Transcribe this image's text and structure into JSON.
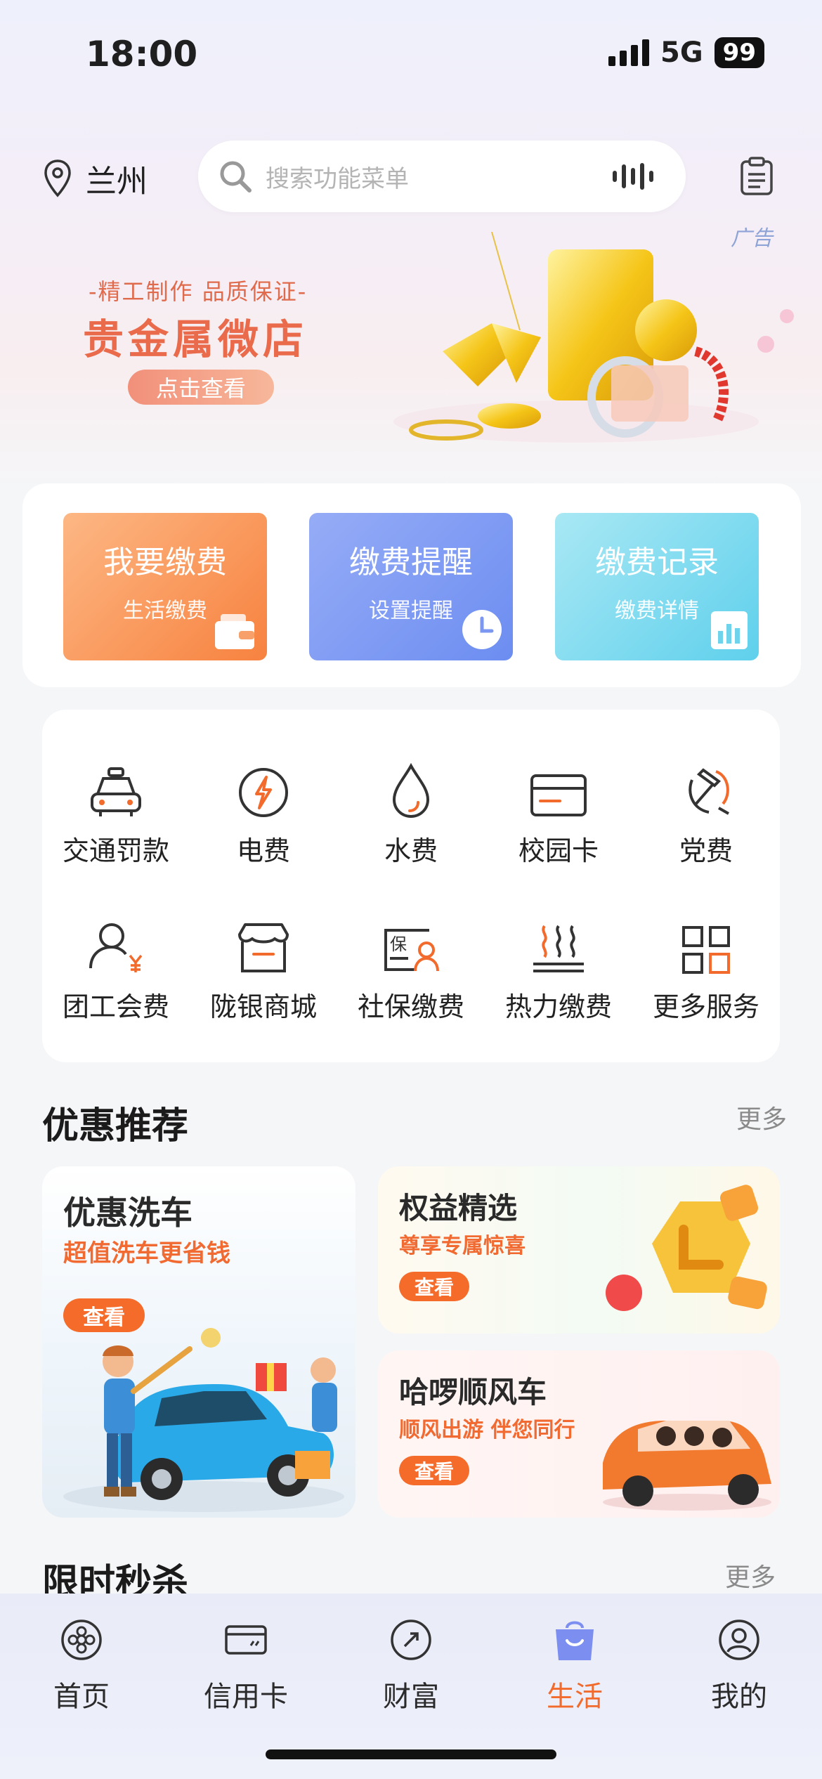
{
  "status": {
    "time": "18:00",
    "network": "5G",
    "battery": "99"
  },
  "header": {
    "location": "兰州",
    "search_placeholder": "搜索功能菜单",
    "ad_label": "广告"
  },
  "banner": {
    "subtitle": "-精工制作 品质保证-",
    "title": "贵金属微店",
    "button": "点击查看"
  },
  "quick_actions": [
    {
      "title": "我要缴费",
      "sub": "生活缴费",
      "icon": "wallet-icon"
    },
    {
      "title": "缴费提醒",
      "sub": "设置提醒",
      "icon": "clock-icon"
    },
    {
      "title": "缴费记录",
      "sub": "缴费详情",
      "icon": "chart-icon"
    }
  ],
  "services": [
    {
      "label": "交通罚款",
      "icon": "car-icon"
    },
    {
      "label": "电费",
      "icon": "lightning-icon"
    },
    {
      "label": "水费",
      "icon": "water-drop-icon"
    },
    {
      "label": "校园卡",
      "icon": "card-icon"
    },
    {
      "label": "党费",
      "icon": "party-emblem-icon"
    },
    {
      "label": "团工会费",
      "icon": "union-fee-icon"
    },
    {
      "label": "陇银商城",
      "icon": "store-icon"
    },
    {
      "label": "社保缴费",
      "icon": "social-security-icon"
    },
    {
      "label": "热力缴费",
      "icon": "heating-icon"
    },
    {
      "label": "更多服务",
      "icon": "grid-icon"
    }
  ],
  "promo_section": {
    "title": "优惠推荐",
    "more": "更多"
  },
  "promos": [
    {
      "title": "优惠洗车",
      "sub": "超值洗车更省钱",
      "button": "查看"
    },
    {
      "title": "权益精选",
      "sub": "尊享专属惊喜",
      "button": "查看"
    },
    {
      "title": "哈啰顺风车",
      "sub": "顺风出游 伴您同行",
      "button": "查看"
    }
  ],
  "flash_section": {
    "title": "限时秒杀",
    "more": "更多"
  },
  "tabs": [
    {
      "label": "首页",
      "icon": "home-icon",
      "active": false
    },
    {
      "label": "信用卡",
      "icon": "credit-card-icon",
      "active": false
    },
    {
      "label": "财富",
      "icon": "wealth-icon",
      "active": false
    },
    {
      "label": "生活",
      "icon": "shopping-bag-icon",
      "active": true
    },
    {
      "label": "我的",
      "icon": "profile-icon",
      "active": false
    }
  ],
  "colors": {
    "accent": "#f56b2a",
    "active_tab": "#f26b2c",
    "pay_orange": "#f7823f",
    "pay_blue": "#6c8df1",
    "pay_cyan": "#5fd0ec"
  }
}
